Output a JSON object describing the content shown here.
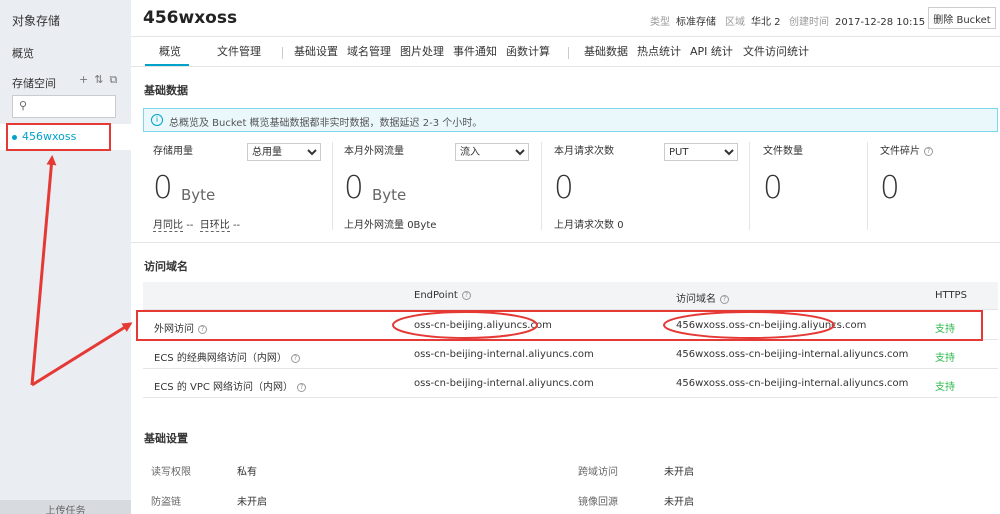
{
  "sidebar": {
    "title": "对象存储",
    "overview": "概览",
    "storage_label": "存储空间",
    "tool_add": "+",
    "tool_2": "⇅",
    "tool_3": "⧉",
    "search_placeholder": "",
    "bucket_name": "456wxoss",
    "upload_label": "上传任务"
  },
  "header": {
    "bucket_title": "456wxoss",
    "type_label": "类型",
    "type_value": "标准存储",
    "region_label": "区域",
    "region_value": "华北 2",
    "created_label": "创建时间",
    "created_value": "2017-12-28 10:15",
    "delete_button": "删除 Bucket"
  },
  "tabs": [
    "概览",
    "文件管理",
    "基础设置",
    "域名管理",
    "图片处理",
    "事件通知",
    "函数计算",
    "基础数据",
    "热点统计",
    "API 统计",
    "文件访问统计"
  ],
  "basic_data": {
    "title": "基础数据",
    "info": "总概览及 Bucket 概览基础数据都非实时数据，数据延迟 2-3 个小时。",
    "stats": [
      {
        "label": "存储用量",
        "select": "总用量",
        "value": "0",
        "unit": "Byte",
        "sub_a": "月同比",
        "sub_a_val": "--",
        "sub_b": "日环比",
        "sub_b_val": "--"
      },
      {
        "label": "本月外网流量",
        "select": "流入",
        "value": "0",
        "unit": "Byte",
        "sub": "上月外网流量",
        "sub_val": "0Byte"
      },
      {
        "label": "本月请求次数",
        "select": "PUT",
        "value": "0",
        "sub": "上月请求次数",
        "sub_val": "0"
      },
      {
        "label": "文件数量",
        "value": "0"
      },
      {
        "label": "文件碎片",
        "value": "0"
      }
    ]
  },
  "domains": {
    "title": "访问域名",
    "col_endpoint": "EndPoint",
    "col_domain": "访问域名",
    "col_https": "HTTPS",
    "rows": [
      {
        "type": "外网访问",
        "endpoint": "oss-cn-beijing.aliyuncs.com",
        "domain": "456wxoss.oss-cn-beijing.aliyuncs.com",
        "https": "支持"
      },
      {
        "type": "ECS 的经典网络访问（内网）",
        "endpoint": "oss-cn-beijing-internal.aliyuncs.com",
        "domain": "456wxoss.oss-cn-beijing-internal.aliyuncs.com",
        "https": "支持"
      },
      {
        "type": "ECS 的 VPC 网络访问（内网）",
        "endpoint": "oss-cn-beijing-internal.aliyuncs.com",
        "domain": "456wxoss.oss-cn-beijing-internal.aliyuncs.com",
        "https": "支持"
      }
    ]
  },
  "settings": {
    "title": "基础设置",
    "rw_label": "读写权限",
    "rw_value": "私有",
    "cors_label": "跨域访问",
    "cors_value": "未开启",
    "hotlink_label": "防盗链",
    "hotlink_value": "未开启",
    "mirror_label": "镜像回源",
    "mirror_value": "未开启"
  },
  "colors": {
    "accent": "#00a2ca",
    "annotation": "#e53935",
    "success": "#2db84d"
  }
}
